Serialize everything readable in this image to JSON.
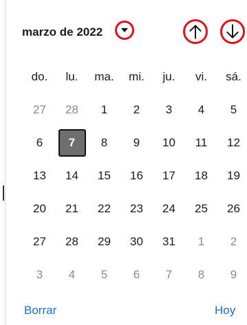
{
  "header": {
    "month_label": "marzo de 2022",
    "caret_icon": "caret-down-icon",
    "prev_icon": "arrow-up-icon",
    "next_icon": "arrow-down-icon",
    "highlight_color": "#e0121b"
  },
  "weekdays": [
    "do.",
    "lu.",
    "ma.",
    "mi.",
    "ju.",
    "vi.",
    "sá."
  ],
  "weeks": [
    [
      {
        "d": "27",
        "o": true
      },
      {
        "d": "28",
        "o": true
      },
      {
        "d": "1"
      },
      {
        "d": "2"
      },
      {
        "d": "3"
      },
      {
        "d": "4"
      },
      {
        "d": "5"
      }
    ],
    [
      {
        "d": "6"
      },
      {
        "d": "7",
        "s": true
      },
      {
        "d": "8"
      },
      {
        "d": "9"
      },
      {
        "d": "10"
      },
      {
        "d": "11"
      },
      {
        "d": "12"
      }
    ],
    [
      {
        "d": "13"
      },
      {
        "d": "14"
      },
      {
        "d": "15"
      },
      {
        "d": "16"
      },
      {
        "d": "17"
      },
      {
        "d": "18"
      },
      {
        "d": "19"
      }
    ],
    [
      {
        "d": "20"
      },
      {
        "d": "21"
      },
      {
        "d": "22"
      },
      {
        "d": "23"
      },
      {
        "d": "24"
      },
      {
        "d": "25"
      },
      {
        "d": "26"
      }
    ],
    [
      {
        "d": "27"
      },
      {
        "d": "28"
      },
      {
        "d": "29"
      },
      {
        "d": "30"
      },
      {
        "d": "31"
      },
      {
        "d": "1",
        "o": true
      },
      {
        "d": "2",
        "o": true
      }
    ],
    [
      {
        "d": "3",
        "o": true
      },
      {
        "d": "4",
        "o": true
      },
      {
        "d": "5",
        "o": true
      },
      {
        "d": "6",
        "o": true
      },
      {
        "d": "7",
        "o": true
      },
      {
        "d": "8",
        "o": true
      },
      {
        "d": "9",
        "o": true
      }
    ]
  ],
  "footer": {
    "clear_label": "Borrar",
    "today_label": "Hoy",
    "link_color": "#1a73c9"
  }
}
